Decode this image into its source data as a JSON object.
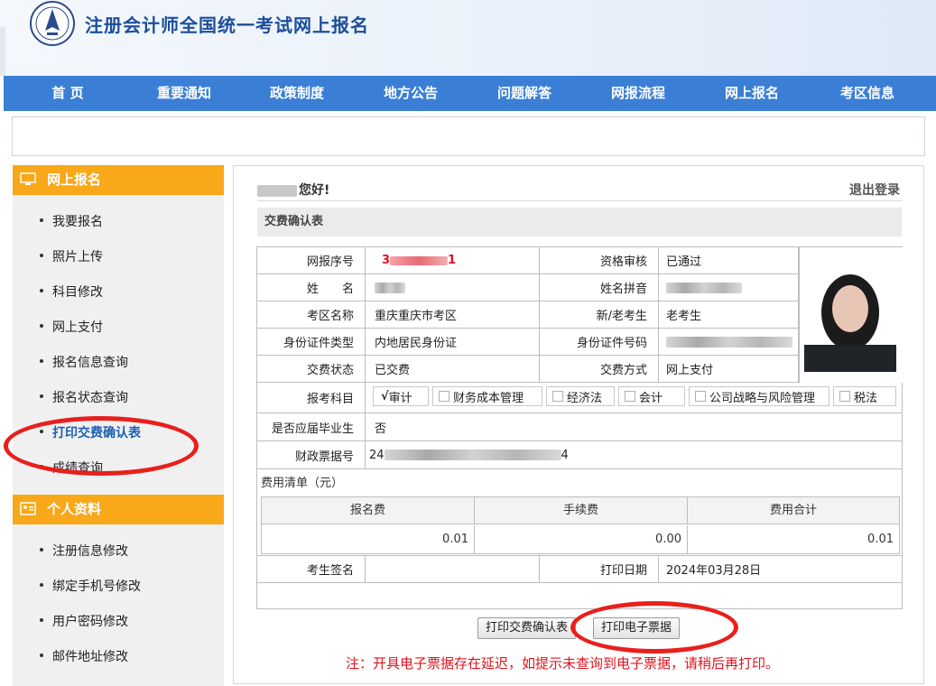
{
  "header": {
    "site_title": "注册会计师全国统一考试网上报名"
  },
  "nav": [
    "首 页",
    "重要通知",
    "政策制度",
    "地方公告",
    "问题解答",
    "网报流程",
    "网上报名",
    "考区信息"
  ],
  "sidebar": {
    "section1_title": "网上报名",
    "section1_items": [
      "我要报名",
      "照片上传",
      "科目修改",
      "网上支付",
      "报名信息查询",
      "报名状态查询",
      "打印交费确认表",
      "成绩查询"
    ],
    "active_item": "打印交费确认表",
    "section2_title": "个人资料",
    "section2_items": [
      "注册信息修改",
      "绑定手机号修改",
      "用户密码修改",
      "邮件地址修改"
    ]
  },
  "main": {
    "greeting": "您好!",
    "logout": "退出登录",
    "section_title": "交费确认表",
    "form": {
      "reg_no_label": "网报序号",
      "reg_no_prefix": "3",
      "reg_no_suffix": "1",
      "qual_label": "资格审核",
      "qual_value": "已通过",
      "name_label": "姓　　名",
      "pinyin_label": "姓名拼音",
      "region_label": "考区名称",
      "region_value": "重庆重庆市考区",
      "new_old_label": "新/老考生",
      "new_old_value": "老考生",
      "idtype_label": "身份证件类型",
      "idtype_value": "内地居民身份证",
      "idno_label": "身份证件号码",
      "paystatus_label": "交费状态",
      "paystatus_value": "已交费",
      "paymethod_label": "交费方式",
      "paymethod_value": "网上支付",
      "subjects_label": "报考科目",
      "subjects": [
        {
          "name": "审计",
          "checked": true
        },
        {
          "name": "财务成本管理",
          "checked": false
        },
        {
          "name": "经济法",
          "checked": false
        },
        {
          "name": "会计",
          "checked": false
        },
        {
          "name": "公司战略与风险管理",
          "checked": false
        },
        {
          "name": "税法",
          "checked": false
        }
      ],
      "check_mark": "√",
      "graduate_label": "是否应届毕业生",
      "graduate_value": "否",
      "receipt_label": "财政票据号",
      "receipt_prefix": "24",
      "receipt_suffix": "4",
      "fee_list_label": "费用清单（元）",
      "fee_headers": [
        "报名费",
        "手续费",
        "费用合计"
      ],
      "fee_values": [
        "0.01",
        "0.00",
        "0.01"
      ],
      "signature_label": "考生签名",
      "print_date_label": "打印日期",
      "print_date_value": "2024年03月28日"
    },
    "btn_print_confirm": "打印交费确认表",
    "btn_print_receipt": "打印电子票据",
    "note": "注：开具电子票据存在延迟，如提示未查询到电子票据，请稍后再打印。"
  },
  "colors": {
    "nav": "#3a7fd5",
    "sidebar_head": "#f8a818",
    "highlight": "#e8201c"
  }
}
